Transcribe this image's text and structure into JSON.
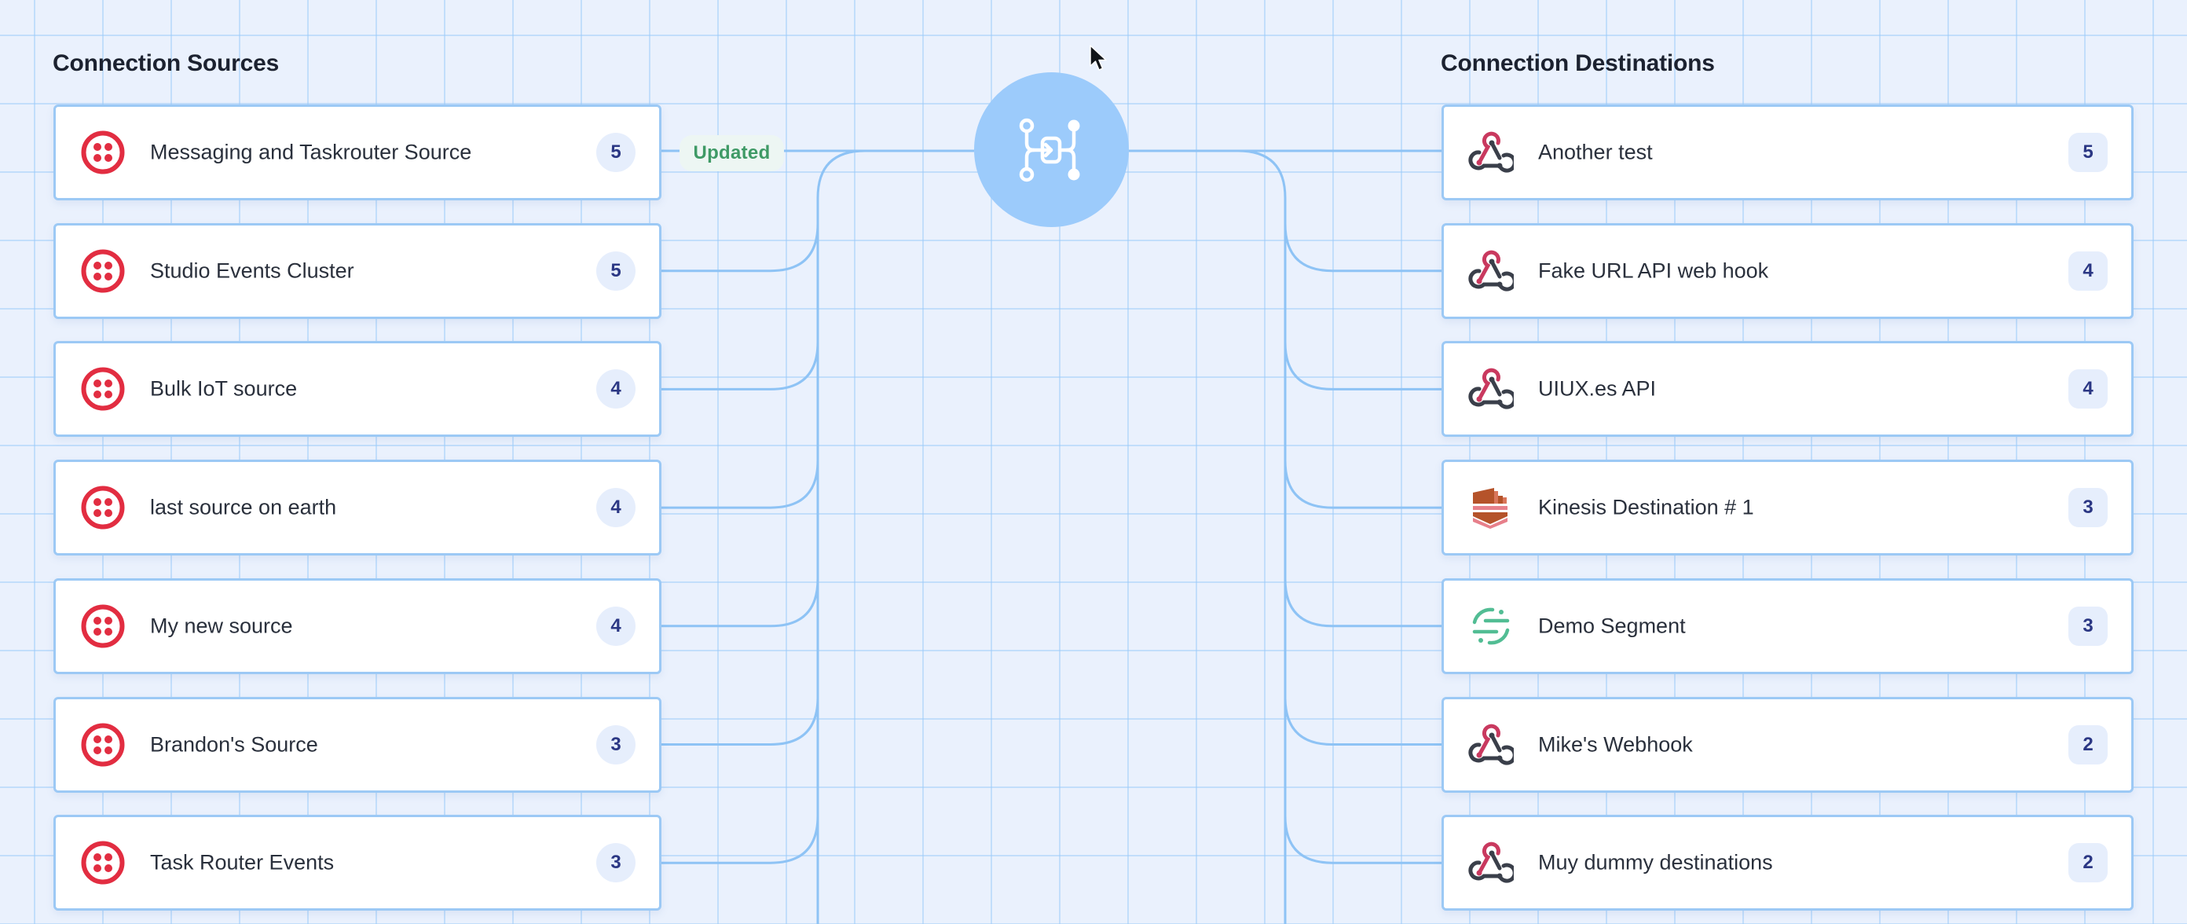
{
  "sources": {
    "title": "Connection Sources",
    "items": [
      {
        "name": "Messaging and Taskrouter Source",
        "count": "5",
        "icon": "twilio-icon",
        "status": "Updated"
      },
      {
        "name": "Studio Events Cluster",
        "count": "5",
        "icon": "twilio-icon"
      },
      {
        "name": "Bulk IoT source",
        "count": "4",
        "icon": "twilio-icon"
      },
      {
        "name": "last source on earth",
        "count": "4",
        "icon": "twilio-icon"
      },
      {
        "name": "My new source",
        "count": "4",
        "icon": "twilio-icon"
      },
      {
        "name": "Brandon's Source",
        "count": "3",
        "icon": "twilio-icon"
      },
      {
        "name": "Task Router Events",
        "count": "3",
        "icon": "twilio-icon"
      }
    ]
  },
  "destinations": {
    "title": "Connection Destinations",
    "items": [
      {
        "name": "Another test",
        "count": "5",
        "icon": "webhook-icon"
      },
      {
        "name": "Fake URL API web hook",
        "count": "4",
        "icon": "webhook-icon"
      },
      {
        "name": "UIUX.es API",
        "count": "4",
        "icon": "webhook-icon"
      },
      {
        "name": "Kinesis Destination # 1",
        "count": "3",
        "icon": "kinesis-icon"
      },
      {
        "name": "Demo Segment",
        "count": "3",
        "icon": "segment-icon"
      },
      {
        "name": "Mike's Webhook",
        "count": "2",
        "icon": "webhook-icon"
      },
      {
        "name": "Muy dummy destinations",
        "count": "2",
        "icon": "webhook-icon"
      }
    ]
  },
  "hub": {
    "icon": "event-streams-hub-icon"
  },
  "colors": {
    "background": "#eaf1fd",
    "grid": "#a0cdfa",
    "connector": "#8ec3f5",
    "card_border": "#9cc9f5",
    "hub": "#9ccbfb",
    "twilio_red": "#e22d41",
    "webhook_red": "#c9395f",
    "webhook_gray": "#3a3f4a",
    "kinesis": "#b5532a",
    "segment_green": "#52bd94",
    "badge_bg": "#e6eefc",
    "badge_text": "#2b3784",
    "updated_text": "#3f9a66",
    "updated_bg": "#edf6f3"
  }
}
